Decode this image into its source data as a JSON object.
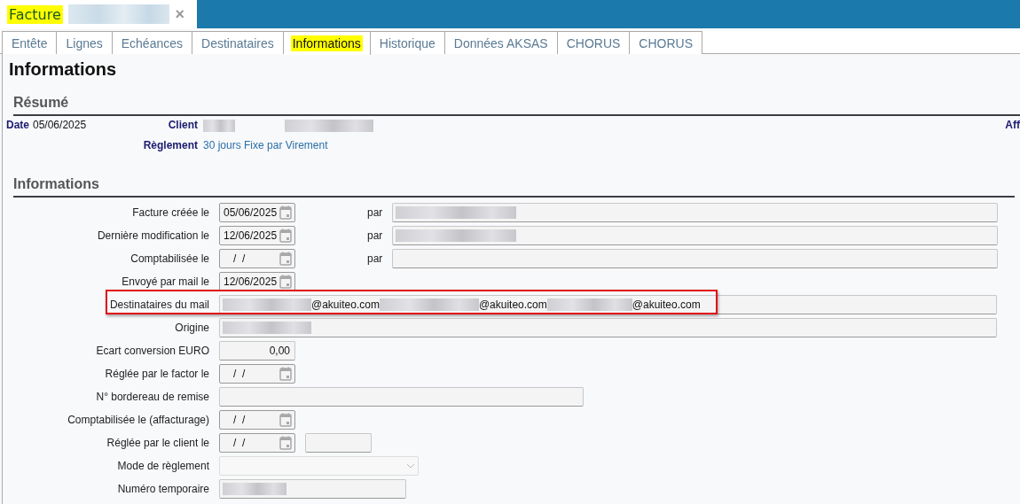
{
  "window": {
    "title": "Facture",
    "title_highlighted": true,
    "title_redacted": true,
    "close": "×"
  },
  "tabs": [
    {
      "label": "Entête",
      "selected": false,
      "highlighted": false
    },
    {
      "label": "Lignes",
      "selected": false,
      "highlighted": false
    },
    {
      "label": "Echéances",
      "selected": false,
      "highlighted": false
    },
    {
      "label": "Destinataires",
      "selected": false,
      "highlighted": false
    },
    {
      "label": "Informations",
      "selected": true,
      "highlighted": true
    },
    {
      "label": "Historique",
      "selected": false,
      "highlighted": false
    },
    {
      "label": "Données AKSAS",
      "selected": false,
      "highlighted": false
    },
    {
      "label": "CHORUS",
      "selected": false,
      "highlighted": false
    },
    {
      "label": "CHORUS",
      "selected": false,
      "highlighted": false
    }
  ],
  "page_title": "Informations",
  "summary": {
    "heading": "Résumé",
    "date_label": "Date",
    "date": "05/06/2025",
    "client_label": "Client",
    "payment_label": "Règlement",
    "payment": "30 jours Fixe par Virement",
    "right_label": "Aff"
  },
  "info": {
    "heading": "Informations",
    "rows": [
      {
        "kind": "date",
        "label": "Facture créée le",
        "value": "05/06/2025",
        "by_label": "par",
        "by_redacted": true
      },
      {
        "kind": "date",
        "label": "Dernière modification le",
        "value": "12/06/2025",
        "by_label": "par",
        "by_redacted": true
      },
      {
        "kind": "date",
        "label": "Comptabilisée le",
        "value": "/  /",
        "by_label": "par",
        "by_redacted": false
      },
      {
        "kind": "date",
        "label": "Envoyé par mail le",
        "value": "12/06/2025"
      },
      {
        "kind": "emails",
        "label": "Destinataires du mail",
        "highlighted": true,
        "emails": [
          "@akuiteo.com",
          "@akuiteo.com",
          "@akuiteo.com"
        ]
      },
      {
        "kind": "wide",
        "label": "Origine",
        "redacted": true
      },
      {
        "kind": "amount",
        "label": "Ecart conversion EURO",
        "value": "0,00"
      },
      {
        "kind": "date",
        "label": "Réglée par le factor le",
        "value": "/  /"
      },
      {
        "kind": "medium",
        "label": "N° bordereau de remise"
      },
      {
        "kind": "date",
        "label": "Comptabilisée le (affacturage)",
        "value": "/  /"
      },
      {
        "kind": "date",
        "label": "Réglée par le client le",
        "value": "/  /",
        "extra_field": true
      },
      {
        "kind": "select",
        "label": "Mode de règlement",
        "disabled": true
      },
      {
        "kind": "short",
        "label": "Numéro temporaire",
        "redacted": true
      }
    ]
  }
}
